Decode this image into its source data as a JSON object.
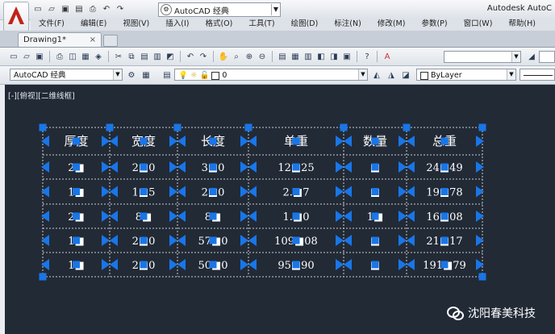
{
  "app": {
    "window_title": "Autodesk AutoC",
    "workspace": "AutoCAD 经典"
  },
  "menu": [
    "文件(F)",
    "编辑(E)",
    "视图(V)",
    "插入(I)",
    "格式(O)",
    "工具(T)",
    "绘图(D)",
    "标注(N)",
    "修改(M)",
    "参数(P)",
    "窗口(W)",
    "帮助(H)"
  ],
  "tabs": [
    {
      "label": "Drawing1*",
      "close": "×"
    }
  ],
  "toolbar2": {
    "workspace_combo": "AutoCAD 经典",
    "layer_combo": "0",
    "color_combo": "ByLayer"
  },
  "viewport": {
    "label": "[-][俯视][二维线框]"
  },
  "table": {
    "headers": [
      "厚度",
      "宽度",
      "长度",
      "单重",
      "数量",
      "总重"
    ],
    "rows": [
      [
        "2■",
        "2■0",
        "3■0",
        "12■25",
        "■",
        "24■49"
      ],
      [
        "1■",
        "1■5",
        "2■0",
        "2.■7",
        "■",
        "19■78"
      ],
      [
        "2■",
        "8■",
        "8■",
        "1.■0",
        "1■",
        "16■08"
      ],
      [
        "1■",
        "2■0",
        "57■0",
        "109■08",
        "■",
        "21■17"
      ],
      [
        "1■",
        "2■0",
        "50■0",
        "95■90",
        "■",
        "191■79"
      ]
    ]
  },
  "watermark": {
    "text": "沈阳春美科技"
  },
  "colors": {
    "grip": "#1976e8",
    "canvas": "#222a36",
    "table_line": "#c8ccd2",
    "text": "#ffffff"
  }
}
